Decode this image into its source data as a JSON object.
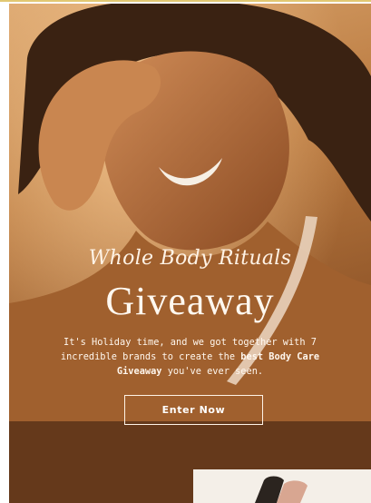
{
  "hero": {
    "title_script": "Whole Body Rituals",
    "title_main": "Giveaway",
    "intro": {
      "part1": "It's Holiday time, and we got together with 7 incredible brands to create the ",
      "bold1": "best Body Care Giveaway",
      "part2": " you've ever seen."
    },
    "cta_label": "Enter Now"
  },
  "colors": {
    "accent_top_border": "#e2c873",
    "hero_bg": "#b9793f",
    "text": "#fff7ee"
  }
}
